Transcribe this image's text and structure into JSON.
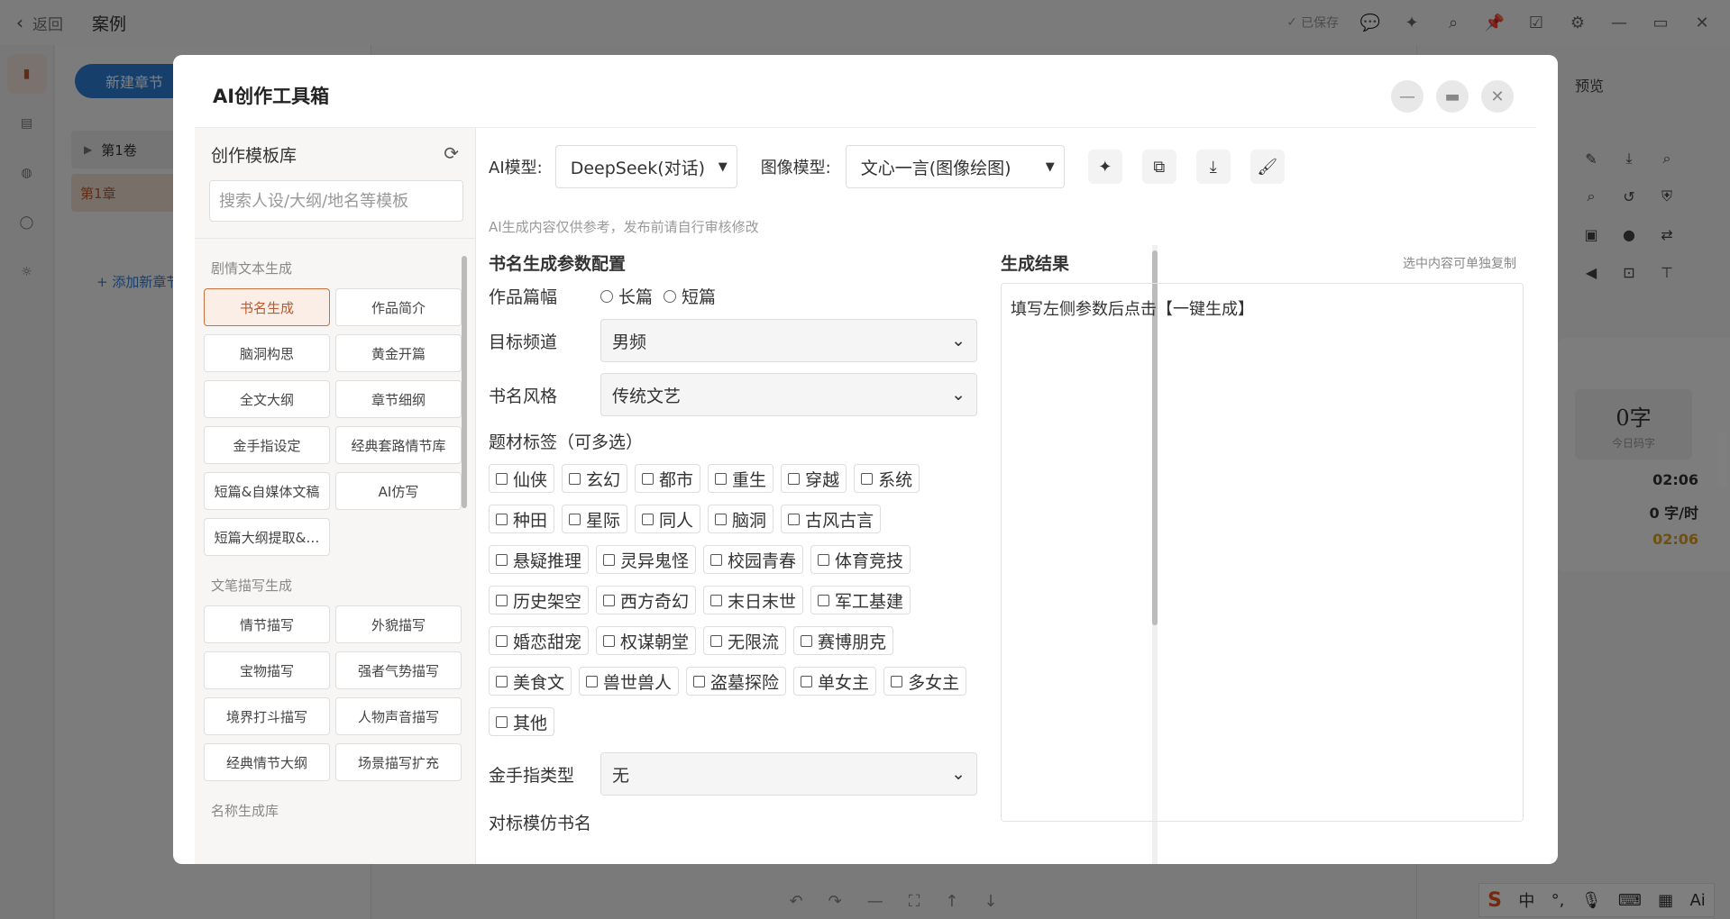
{
  "app": {
    "back_label": "返回",
    "title": "案例",
    "saved_label": "已保存"
  },
  "chapters": {
    "new_chapter_label": "新建章节",
    "volume_label": "第1卷",
    "chapter_label": "第1章",
    "add_chapter_label": "+ 添加新章节"
  },
  "right_panel": {
    "preview_label": "预览",
    "word_count": "0字",
    "word_count_label": "今日码字",
    "time_1": "02:06",
    "speed": "0 字/时",
    "time_2": "02:06"
  },
  "modal": {
    "title": "AI创作工具箱",
    "library": {
      "title": "创作模板库",
      "search_placeholder": "搜索人设/大纲/地名等模板",
      "sections": [
        {
          "title": "剧情文本生成",
          "items": [
            "书名生成",
            "作品简介",
            "脑洞构思",
            "黄金开篇",
            "全文大纲",
            "章节细纲",
            "金手指设定",
            "经典套路情节库",
            "短篇&自媒体文稿",
            "AI仿写",
            "短篇大纲提取&…"
          ]
        },
        {
          "title": "文笔描写生成",
          "items": [
            "情节描写",
            "外貌描写",
            "宝物描写",
            "强者气势描写",
            "境界打斗描写",
            "人物声音描写",
            "经典情节大纲",
            "场景描写扩充"
          ]
        },
        {
          "title": "名称生成库",
          "items": []
        }
      ]
    },
    "ai_model_label": "AI模型:",
    "ai_model_value": "DeepSeek(对话)",
    "image_model_label": "图像模型:",
    "image_model_value": "文心一言(图像绘图)",
    "disclaimer": "AI生成内容仅供参考，发布前请自行审核修改",
    "config": {
      "title": "书名生成参数配置",
      "length_label": "作品篇幅",
      "length_options": [
        "长篇",
        "短篇"
      ],
      "channel_label": "目标频道",
      "channel_value": "男频",
      "style_label": "书名风格",
      "style_value": "传统文艺",
      "tags_label": "题材标签（可多选）",
      "tags": [
        "仙侠",
        "玄幻",
        "都市",
        "重生",
        "穿越",
        "系统",
        "种田",
        "星际",
        "同人",
        "脑洞",
        "古风古言",
        "悬疑推理",
        "灵异鬼怪",
        "校园青春",
        "体育竞技",
        "历史架空",
        "西方奇幻",
        "末日末世",
        "军工基建",
        "婚恋甜宠",
        "权谋朝堂",
        "无限流",
        "赛博朋克",
        "美食文",
        "兽世兽人",
        "盗墓探险",
        "单女主",
        "多女主",
        "其他"
      ],
      "cheat_label": "金手指类型",
      "cheat_value": "无",
      "imitate_label": "对标模仿书名"
    },
    "result": {
      "title": "生成结果",
      "hint": "选中内容可单独复制",
      "placeholder": "填写左侧参数后点击【一键生成】"
    }
  },
  "ime": {
    "lang": "中",
    "ai_label": "Ai"
  },
  "colors": {
    "accent": "#c0582b",
    "primary_button": "#2f7fd8",
    "highlight_time": "#e0a020"
  }
}
